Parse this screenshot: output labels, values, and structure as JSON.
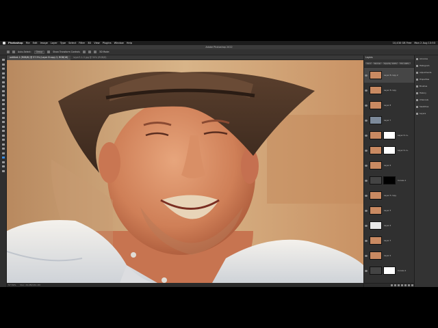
{
  "menubar": {
    "app_name": "Photoshop",
    "items": [
      "File",
      "Edit",
      "Image",
      "Layer",
      "Type",
      "Select",
      "Filter",
      "3D",
      "View",
      "Plugins",
      "Window",
      "Help"
    ],
    "status_memory": "10,430 GB Free",
    "datetime": "Mon 2 Aug 13:53"
  },
  "window_title": "Adobe Photoshop 2022",
  "options_bar": {
    "tool_label": "Auto-Select:",
    "target": "Group",
    "transform": "Show Transform Controls",
    "mode_3d": "3D Mode:"
  },
  "document": {
    "active_tab": "untitled-1 (RGB/8) @ 57.5% (Layer 8 copy 2, RGB/16)",
    "second_tab": "layer3-1-3.jpg @ 50% (RGB/8)",
    "zoom": "57.59%",
    "doc_info": "Doc: 24.2M/132.1M"
  },
  "layers_panel": {
    "title": "Layers",
    "kind": "Kind",
    "blend": "Normal",
    "opacity": "Opacity: 100%",
    "fill": "Fill: 100%",
    "items": [
      {
        "name": "Layer 8 copy 2",
        "thumb": "face",
        "mask": "none",
        "selected": true
      },
      {
        "name": "Layer 8 copy",
        "thumb": "face",
        "mask": "none",
        "selected": false
      },
      {
        "name": "Layer 8",
        "thumb": "face",
        "mask": "none",
        "selected": false
      },
      {
        "name": "Layer 7",
        "thumb": "hat",
        "mask": "none",
        "selected": false
      },
      {
        "name": "Layer 6 co..",
        "thumb": "face",
        "mask": "white",
        "selected": false
      },
      {
        "name": "Layer 6 co..",
        "thumb": "face",
        "mask": "white",
        "selected": false
      },
      {
        "name": "Layer 6",
        "thumb": "face",
        "mask": "none",
        "selected": false
      },
      {
        "name": "Curves 1",
        "thumb": "adjust",
        "mask": "black",
        "selected": false
      },
      {
        "name": "Layer 5 copy",
        "thumb": "face",
        "mask": "none",
        "selected": false
      },
      {
        "name": "Layer 5",
        "thumb": "face",
        "mask": "none",
        "selected": false
      },
      {
        "name": "Layer 4",
        "thumb": "bw",
        "mask": "none",
        "selected": false
      },
      {
        "name": "Layer 3",
        "thumb": "face",
        "mask": "none",
        "selected": false
      },
      {
        "name": "Layer 2",
        "thumb": "face",
        "mask": "none",
        "selected": false
      },
      {
        "name": "Curves 2",
        "thumb": "adjust",
        "mask": "white",
        "selected": false
      }
    ]
  },
  "right_panels": [
    "Libraries",
    "Histogram",
    "Adjustments",
    "Properties",
    "Brushes",
    "History",
    "Channels",
    "Swatches",
    "Layers"
  ],
  "colors": {
    "accent": "#3d8ee0",
    "panel_bg": "#303030",
    "canvas_bg": "#caa57a"
  }
}
